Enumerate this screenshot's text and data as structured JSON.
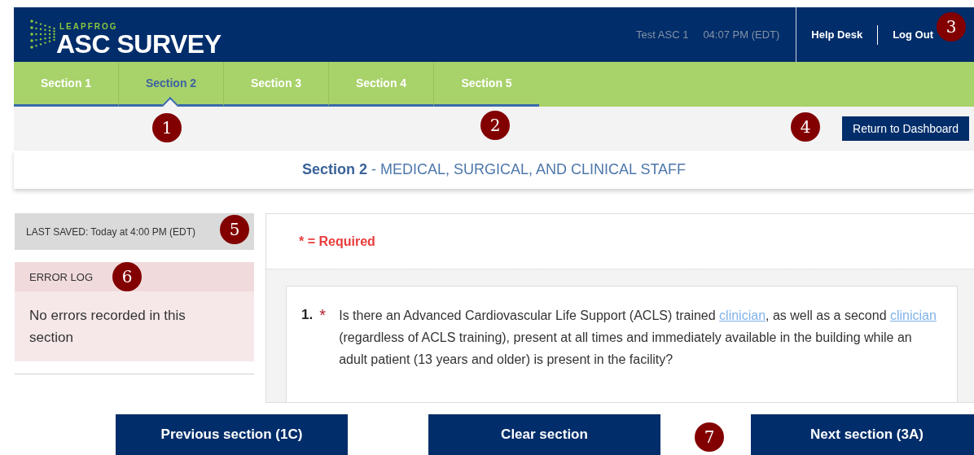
{
  "header": {
    "logo_small": "LEAPFROG",
    "logo_large": "ASC SURVEY",
    "user": "Test ASC 1",
    "time": "04:07 PM (EDT)",
    "links": [
      "Help Desk",
      "Log Out"
    ]
  },
  "tabs": [
    {
      "label": "Section 1",
      "selected": false
    },
    {
      "label": "Section 2",
      "selected": true
    },
    {
      "label": "Section 3",
      "selected": false
    },
    {
      "label": "Section 4",
      "selected": false
    },
    {
      "label": "Section 5",
      "selected": false
    }
  ],
  "dashboard_button": "Return to Dashboard",
  "section_title": {
    "name": "Section 2",
    "subtitle": "- MEDICAL, SURGICAL, AND CLINICAL STAFF"
  },
  "last_saved": "LAST SAVED: Today at 4:00 PM (EDT)",
  "error_log": {
    "title": "ERROR LOG",
    "message": "No errors recorded in this section"
  },
  "required_note": "* = Required",
  "questions": [
    {
      "number": "1.",
      "required_mark": "*",
      "parts": [
        {
          "kind": "text",
          "text": "Is there an Advanced Cardiovascular Life Support (ACLS) trained "
        },
        {
          "kind": "link",
          "text": "clinician"
        },
        {
          "kind": "text",
          "text": ", as well as a second "
        },
        {
          "kind": "link",
          "text": "clinician"
        },
        {
          "kind": "text",
          "text": " (regardless of ACLS training), present at all times and immediately available in the building while an adult patient (13 years and older) is present in the facility?"
        }
      ]
    }
  ],
  "footer_buttons": [
    "Previous section (1C)",
    "Clear section",
    "Next section (3A)"
  ],
  "callouts": [
    "1",
    "2",
    "3",
    "4",
    "5",
    "6",
    "7"
  ]
}
